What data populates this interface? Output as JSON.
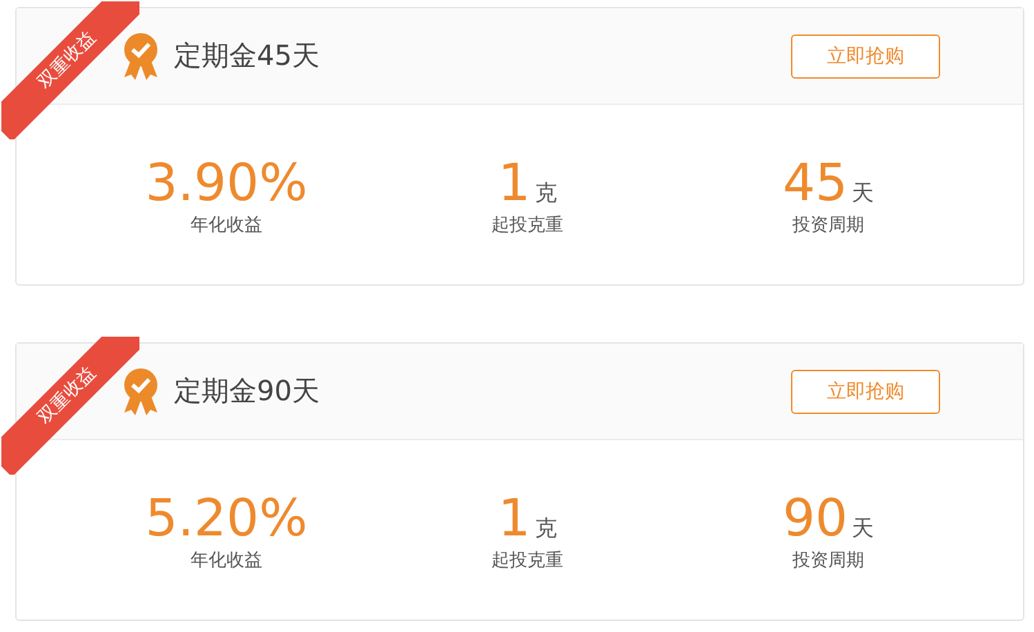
{
  "products": [
    {
      "ribbon": "双重收益",
      "title": "定期金45天",
      "button": "立即抢购",
      "stats": [
        {
          "value": "3.90%",
          "label": "年化收益"
        },
        {
          "value": "1",
          "unit": "克",
          "label": "起投克重"
        },
        {
          "value": "45",
          "unit": "天",
          "label": "投资周期"
        }
      ]
    },
    {
      "ribbon": "双重收益",
      "title": "定期金90天",
      "button": "立即抢购",
      "stats": [
        {
          "value": "5.20%",
          "label": "年化收益"
        },
        {
          "value": "1",
          "unit": "克",
          "label": "起投克重"
        },
        {
          "value": "90",
          "unit": "天",
          "label": "投资周期"
        }
      ]
    }
  ]
}
